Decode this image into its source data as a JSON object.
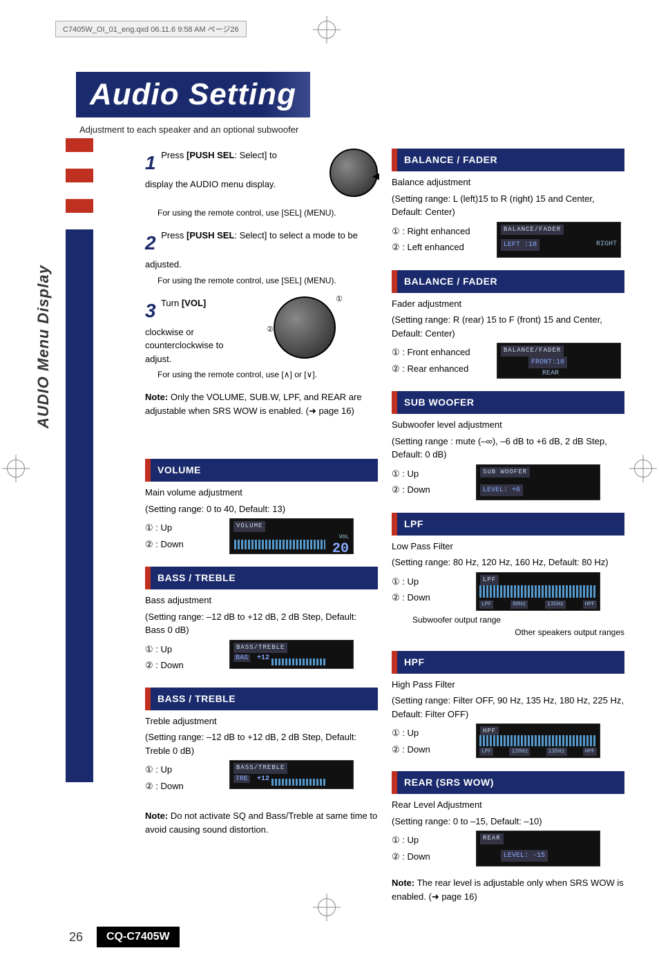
{
  "meta": {
    "file_header": "C7405W_OI_01_eng.qxd  06.11.6  9:58 AM  ページ26"
  },
  "title": "Audio Setting",
  "subtitle": "Adjustment to each speaker and an optional subwoofer",
  "side_tab": "AUDIO Menu Display",
  "steps": {
    "s1": {
      "num": "1",
      "text_before": "Press ",
      "bold": "[PUSH SEL",
      "after_bold": ": Select]",
      "text_after": " to display the AUDIO menu display.",
      "sub": "For using the remote control, use [SEL] (MENU)."
    },
    "s2": {
      "num": "2",
      "text_before": "Press ",
      "bold": "[PUSH SEL",
      "after_bold": ": Select]",
      "text_after": " to select a mode to be adjusted.",
      "sub": "For using the remote control, use [SEL] (MENU)."
    },
    "s3": {
      "num": "3",
      "text_before": "Turn ",
      "bold": "[VOL]",
      "text_after": " clockwise or counterclockwise to adjust.",
      "sub": "For using the remote control, use [∧] or [∨]."
    },
    "note": "Note: Only the VOLUME, SUB.W, LPF, and REAR are adjustable when SRS WOW is enabled. (➜ page 16)"
  },
  "left_sections": {
    "volume": {
      "head": "VOLUME",
      "desc": "Main volume adjustment",
      "range": "(Setting range: 0 to 40, Default: 13)",
      "up": "① : Up",
      "down": "② : Down",
      "disp_title": "VOLUME",
      "disp_small": "VOL",
      "disp_val": "20"
    },
    "bass": {
      "head": "BASS / TREBLE",
      "desc": "Bass adjustment",
      "range": "(Setting range: –12 dB to +12 dB, 2 dB Step, Default: Bass 0 dB)",
      "up": "① : Up",
      "down": "② : Down",
      "disp_title": "BASS/TREBLE",
      "disp_label": "BAS",
      "disp_val": "+12"
    },
    "treble": {
      "head": "BASS / TREBLE",
      "desc": "Treble adjustment",
      "range": "(Setting range: –12 dB to +12 dB, 2 dB Step, Default: Treble 0 dB)",
      "up": "① : Up",
      "down": "② : Down",
      "disp_title": "BASS/TREBLE",
      "disp_label": "TRE",
      "disp_val": "+12"
    },
    "note": "Note: Do not activate SQ and Bass/Treble at same time to avoid causing sound distortion."
  },
  "right_sections": {
    "balance": {
      "head": "BALANCE / FADER",
      "desc": "Balance adjustment",
      "range": "(Setting range: L (left)15 to R (right) 15 and Center, Default: Center)",
      "l1": "① : Right enhanced",
      "l2": "② : Left enhanced",
      "disp_title": "BALANCE/FADER",
      "disp_left": "LEFT :10",
      "disp_right": "RIGHT"
    },
    "fader": {
      "head": "BALANCE / FADER",
      "desc": "Fader adjustment",
      "range": "(Setting range: R (rear) 15 to F (front) 15 and Center, Default: Center)",
      "l1": "① : Front enhanced",
      "l2": "② : Rear enhanced",
      "disp_title": "BALANCE/FADER",
      "disp_front": "FRONT:10",
      "disp_rear": "REAR"
    },
    "subw": {
      "head": "SUB WOOFER",
      "desc": "Subwoofer level adjustment",
      "range": "(Setting range : mute (–∞), –6 dB to +6 dB, 2 dB Step, Default: 0 dB)",
      "l1": "① : Up",
      "l2": "② : Down",
      "disp_title": "SUB WOOFER",
      "disp_val": "LEVEL: +6"
    },
    "lpf": {
      "head": "LPF",
      "desc": "Low Pass Filter",
      "range": "(Setting range: 80 Hz, 120 Hz, 160 Hz, Default: 80 Hz)",
      "l1": "① : Up",
      "l2": "② : Down",
      "disp_title": "LPF",
      "disp_l": "LPF",
      "disp_mid": "80Hz",
      "disp_r1": "135Hz",
      "disp_r2": "HPF",
      "cap1": "Subwoofer output range",
      "cap2": "Other speakers output ranges"
    },
    "hpf": {
      "head": "HPF",
      "desc": "High Pass Filter",
      "range": "(Setting range: Filter OFF, 90 Hz, 135 Hz, 180 Hz, 225 Hz, Default: Filter OFF)",
      "l1": "① : Up",
      "l2": "② : Down",
      "disp_title": "HPF",
      "disp_l": "LPF",
      "disp_mid": "120Hz",
      "disp_r1": "135Hz",
      "disp_r2": "HPF"
    },
    "rear": {
      "head": "REAR (SRS WOW)",
      "desc": "Rear Level Adjustment",
      "range": "(Setting range: 0 to –15, Default: –10)",
      "l1": "① : Up",
      "l2": "② : Down",
      "disp_title": "REAR",
      "disp_val": "LEVEL: -15",
      "note": "Note: The rear level is adjustable only when SRS WOW is enabled. (➜ page 16)"
    }
  },
  "footer": {
    "page": "26",
    "model": "CQ-C7405W"
  }
}
